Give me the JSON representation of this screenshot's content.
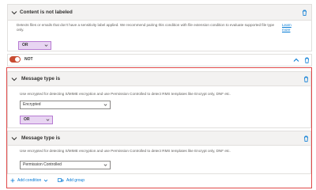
{
  "top_condition": {
    "title": "Content is not labeled",
    "description": "Detects files or emails that don't have a sensitivity label applied. We recommend pairing this condition with file extension condition to evaluate supported file type only.",
    "learn_more": "Learn more",
    "operator": "OR"
  },
  "not_group": {
    "toggle_on": true,
    "label": "NOT",
    "conditions": [
      {
        "title": "Message type is",
        "description": "Use encrypted for detecting S/MIME encryption and use Permission Controlled to detect RMS templates like Encrypt only, DNF etc.",
        "selected": "Encrypted",
        "operator": "OR"
      },
      {
        "title": "Message type is",
        "description": "Use encrypted for detecting S/MIME encryption and use Permission Controlled to detect RMS templates like Encrypt only, DNF etc.",
        "selected": "Permission Controlled"
      }
    ],
    "add_condition": "Add condition",
    "add_group": "Add group"
  },
  "colors": {
    "accent": "#0078d4",
    "toggle": "#c84b31",
    "group_border": "#e04949",
    "operator_fill": "#e8d5f2",
    "operator_border": "#b77bd2"
  },
  "icons": [
    "chevron-down-icon",
    "chevron-up-icon",
    "trash-icon",
    "plus-icon",
    "add-group-icon"
  ]
}
